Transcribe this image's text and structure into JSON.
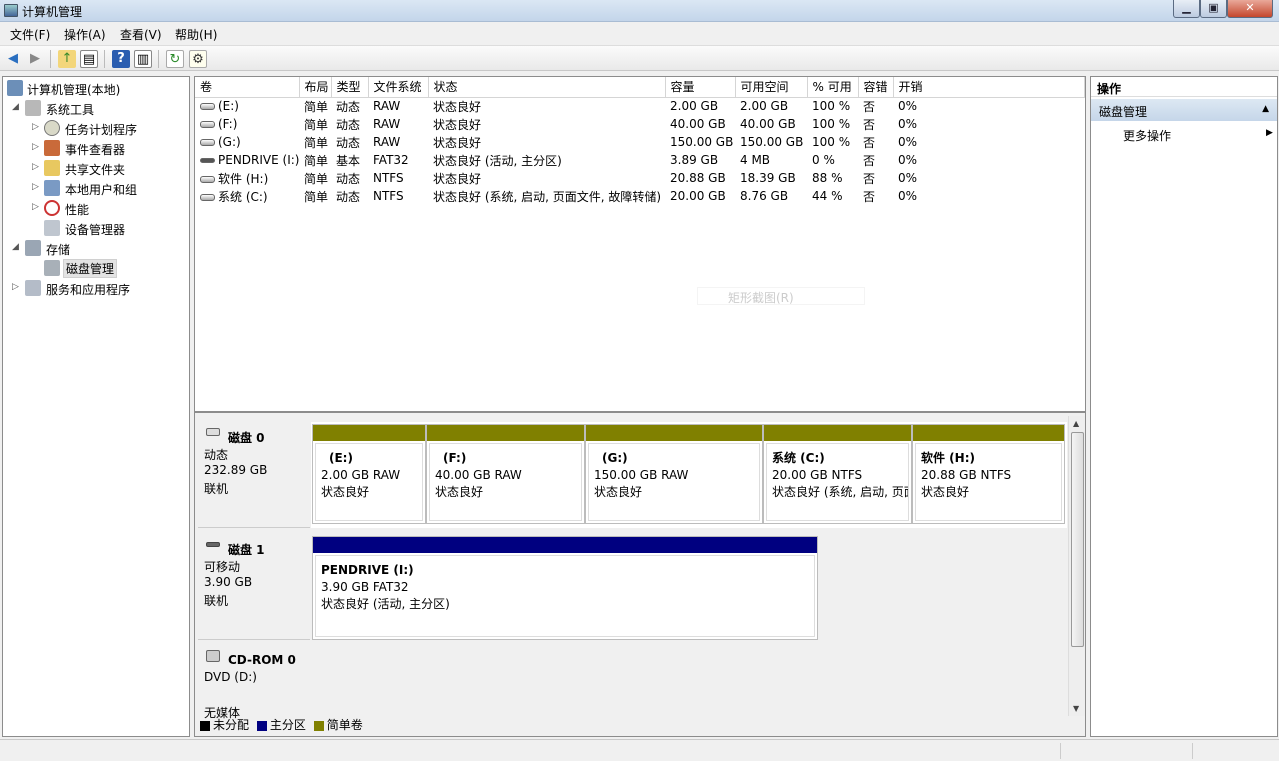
{
  "window": {
    "title": "计算机管理"
  },
  "menu": [
    "文件(F)",
    "操作(A)",
    "查看(V)",
    "帮助(H)"
  ],
  "tree": {
    "root": "计算机管理(本地)",
    "system_tools": "系统工具",
    "task_scheduler": "任务计划程序",
    "event_viewer": "事件查看器",
    "shared_folders": "共享文件夹",
    "local_users": "本地用户和组",
    "performance": "性能",
    "device_manager": "设备管理器",
    "storage": "存储",
    "disk_management": "磁盘管理",
    "services_apps": "服务和应用程序"
  },
  "volumes": {
    "columns": [
      "卷",
      "布局",
      "类型",
      "文件系统",
      "状态",
      "容量",
      "可用空间",
      "% 可用",
      "容错",
      "开销"
    ],
    "rows": [
      [
        "(E:)",
        "简单",
        "动态",
        "RAW",
        "状态良好",
        "2.00 GB",
        "2.00 GB",
        "100 %",
        "否",
        "0%"
      ],
      [
        "(F:)",
        "简单",
        "动态",
        "RAW",
        "状态良好",
        "40.00 GB",
        "40.00 GB",
        "100 %",
        "否",
        "0%"
      ],
      [
        "(G:)",
        "简单",
        "动态",
        "RAW",
        "状态良好",
        "150.00 GB",
        "150.00 GB",
        "100 %",
        "否",
        "0%"
      ],
      [
        "PENDRIVE (I:)",
        "简单",
        "基本",
        "FAT32",
        "状态良好 (活动, 主分区)",
        "3.89 GB",
        "4 MB",
        "0 %",
        "否",
        "0%"
      ],
      [
        "软件 (H:)",
        "简单",
        "动态",
        "NTFS",
        "状态良好",
        "20.88 GB",
        "18.39 GB",
        "88 %",
        "否",
        "0%"
      ],
      [
        "系统 (C:)",
        "简单",
        "动态",
        "NTFS",
        "状态良好 (系统, 启动, 页面文件, 故障转储)",
        "20.00 GB",
        "8.76 GB",
        "44 %",
        "否",
        "0%"
      ]
    ],
    "watermark": "矩形截图(R)"
  },
  "disks": {
    "disk0": {
      "name": "磁盘 0",
      "kind": "动态",
      "size": "232.89 GB",
      "state": "联机",
      "parts": [
        {
          "label": "(E:)",
          "size": "2.00 GB RAW",
          "status": "状态良好"
        },
        {
          "label": "(F:)",
          "size": "40.00 GB RAW",
          "status": "状态良好"
        },
        {
          "label": "(G:)",
          "size": "150.00 GB RAW",
          "status": "状态良好"
        },
        {
          "label": "系统  (C:)",
          "size": "20.00 GB NTFS",
          "status": "状态良好 (系统, 启动, 页面文件, 故障转储)"
        },
        {
          "label": "软件  (H:)",
          "size": "20.88 GB NTFS",
          "status": "状态良好"
        }
      ]
    },
    "disk1": {
      "name": "磁盘 1",
      "kind": "可移动",
      "size": "3.90 GB",
      "state": "联机",
      "parts": [
        {
          "label": "PENDRIVE  (I:)",
          "size": "3.90 GB FAT32",
          "status": "状态良好 (活动, 主分区)"
        }
      ]
    },
    "cdrom0": {
      "name": "CD-ROM 0",
      "kind": "DVD (D:)",
      "state": "无媒体"
    }
  },
  "legend": {
    "unallocated": "未分配",
    "primary": "主分区",
    "simple": "简单卷",
    "colors": {
      "unallocated": "#000000",
      "primary": "#000080",
      "simple": "#808000"
    }
  },
  "actions": {
    "header": "操作",
    "section": "磁盘管理",
    "more": "更多操作"
  }
}
